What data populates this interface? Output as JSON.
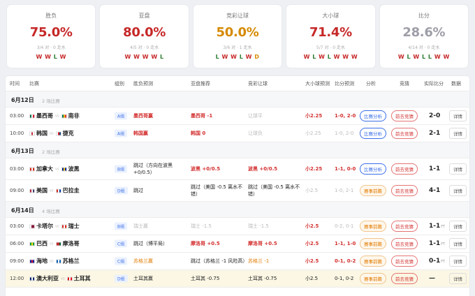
{
  "stats": [
    {
      "label": "胜负",
      "pct": "75.0%",
      "color": "#c62828",
      "sub": "3/4 对 · 0 走水",
      "seq": [
        [
          "W",
          "W"
        ],
        [
          "W",
          "W"
        ],
        [
          "L",
          "L"
        ],
        [
          "W",
          "W"
        ]
      ]
    },
    {
      "label": "亚盘",
      "pct": "80.0%",
      "color": "#c62828",
      "sub": "4/5 对 · 0 走水",
      "seq": [
        [
          "W",
          "W"
        ],
        [
          "W",
          "W"
        ],
        [
          "W",
          "W"
        ],
        [
          "W",
          "W"
        ],
        [
          "L",
          "L"
        ]
      ]
    },
    {
      "label": "竞彩让球",
      "pct": "50.0%",
      "color": "#d68a00",
      "sub": "3/6 对 · 1 走水",
      "seq": [
        [
          "L",
          "L"
        ],
        [
          "W",
          "W"
        ],
        [
          "W",
          "W"
        ],
        [
          "L",
          "L"
        ],
        [
          "W",
          "W"
        ],
        [
          "D",
          "D"
        ]
      ]
    },
    {
      "label": "大小球",
      "pct": "71.4%",
      "color": "#c62828",
      "sub": "5/7 对 · 0 走水",
      "seq": [
        [
          "W",
          "W"
        ],
        [
          "L",
          "L"
        ],
        [
          "W",
          "W"
        ],
        [
          "L",
          "L"
        ],
        [
          "W",
          "W"
        ],
        [
          "W",
          "W"
        ],
        [
          "W",
          "W"
        ]
      ]
    },
    {
      "label": "比分",
      "pct": "28.6%",
      "color": "#9e9ea8",
      "sub": "4/14 对 · 0 走水",
      "seq": [
        [
          "W",
          "W"
        ],
        [
          "L",
          "L"
        ],
        [
          "W",
          "W"
        ],
        [
          "L",
          "L"
        ],
        [
          "L",
          "L"
        ],
        [
          "W",
          "W"
        ],
        [
          "W",
          "W"
        ]
      ]
    }
  ],
  "headers": {
    "time": "时间",
    "match": "比赛",
    "group": "组别",
    "result_pred": "胜负预测",
    "asian": "亚盘推荐",
    "handicap": "竞彩让球",
    "ou_pred": "大小球预测",
    "score_pred": "比分预测",
    "analysis": "分析",
    "quiz": "竞猜",
    "actual": "实际比分",
    "data": "数据"
  },
  "days": [
    {
      "date": "6月12日",
      "count": "2 场比赛",
      "matches": [
        {
          "time": "03:00",
          "home": "墨西哥",
          "away": "南非",
          "f1": [
            "#006847",
            "#fff",
            "#ce1126"
          ],
          "f2": [
            "#007a4d",
            "#ffb612",
            "#de3831"
          ],
          "group": "A组",
          "pred": "墨西哥赢",
          "pred_cls": "red",
          "asian": "墨西哥 -1",
          "asian_cls": "red",
          "hcp": "让球平",
          "hcp_cls": "gray",
          "ou": "小2.25",
          "ou_cls": "red",
          "score": "1-0, 2-0",
          "score_cls": "red",
          "analysis": "比赛分析",
          "an_cls": "btn-blue",
          "quiz": "前去竞猜",
          "actual": "2-0",
          "ft": "",
          "data": "详情",
          "hl": false
        },
        {
          "time": "10:00",
          "home": "韩国",
          "away": "捷克",
          "f1": [
            "#fff",
            "#cd2e3a",
            "#fff"
          ],
          "f2": [
            "#fff",
            "#d7141a",
            "#11457e"
          ],
          "group": "A组",
          "pred": "韩国赢",
          "pred_cls": "red",
          "asian": "韩国 0",
          "asian_cls": "red",
          "hcp": "让球负",
          "hcp_cls": "gray",
          "ou": "小2.25",
          "ou_cls": "gray",
          "score": "1-0, 2-0",
          "score_cls": "gray",
          "analysis": "比赛分析",
          "an_cls": "btn-blue",
          "quiz": "前去竞猜",
          "actual": "2-1",
          "ft": "",
          "data": "详情",
          "hl": false
        }
      ]
    },
    {
      "date": "6月13日",
      "count": "2 场比赛",
      "matches": [
        {
          "time": "03:00",
          "home": "加拿大",
          "away": "波黑",
          "f1": [
            "#d52b1e",
            "#fff",
            "#d52b1e"
          ],
          "f2": [
            "#002395",
            "#fecb00",
            "#002395"
          ],
          "group": "B组",
          "pred": "跳过（方向在波黑+0/0.5）",
          "pred_cls": "",
          "asian": "波黑 +0/0.5",
          "asian_cls": "red",
          "hcp": "波黑 +0/0.5",
          "hcp_cls": "red",
          "ou": "小2.25",
          "ou_cls": "red",
          "score": "1-1, 0-0",
          "score_cls": "red",
          "analysis": "比赛分析",
          "an_cls": "btn-blue",
          "quiz": "前去竞猜",
          "actual": "1-1",
          "ft": "",
          "data": "详情",
          "hl": false
        },
        {
          "time": "09:00",
          "home": "美国",
          "away": "巴拉圭",
          "f1": [
            "#b22234",
            "#fff",
            "#3c3b6e"
          ],
          "f2": [
            "#d52b1e",
            "#fff",
            "#0038a8"
          ],
          "group": "D组",
          "pred": "跳过",
          "pred_cls": "",
          "asian": "跳过（美国 -0.5 离水不错）",
          "asian_cls": "",
          "hcp": "跳过（美国 -0.5 离水不错）",
          "hcp_cls": "",
          "ou": "小2.5",
          "ou_cls": "gray",
          "score": "1-0, 2-1",
          "score_cls": "gray",
          "analysis": "赛事前瞻",
          "an_cls": "btn-orange",
          "quiz": "前去竞猜",
          "actual": "4-1",
          "ft": "",
          "data": "详情",
          "hl": false
        }
      ]
    },
    {
      "date": "6月14日",
      "count": "4 场比赛",
      "matches": [
        {
          "time": "03:00",
          "home": "卡塔尔",
          "away": "瑞士",
          "f1": [
            "#fff",
            "#8a1538",
            "#8a1538"
          ],
          "f2": [
            "#d52b1e",
            "#fff",
            "#d52b1e"
          ],
          "group": "B组",
          "pred": "瑞士赢",
          "pred_cls": "gray",
          "asian": "瑞士 -1.5",
          "asian_cls": "gray",
          "hcp": "瑞士 -1.5",
          "hcp_cls": "gray",
          "ou": "小2.5",
          "ou_cls": "red",
          "score": "0-2, 0-1",
          "score_cls": "gray",
          "analysis": "赛事前瞻",
          "an_cls": "btn-orange",
          "quiz": "前去竞猜",
          "actual": "1-1",
          "ft": "FT",
          "data": "详情",
          "hl": false
        },
        {
          "time": "06:00",
          "home": "巴西",
          "away": "摩洛哥",
          "f1": [
            "#009c3b",
            "#ffdf00",
            "#009c3b"
          ],
          "f2": [
            "#c1272d",
            "#c1272d",
            "#006233"
          ],
          "group": "C组",
          "pred": "跳过（博平局）",
          "pred_cls": "",
          "asian": "摩洛哥 +0.5",
          "asian_cls": "red",
          "hcp": "摩洛哥 +0.5",
          "hcp_cls": "red",
          "ou": "小2.5",
          "ou_cls": "red",
          "score": "1-1, 1-0",
          "score_cls": "red",
          "analysis": "赛事前瞻",
          "an_cls": "btn-orange",
          "quiz": "前去竞猜",
          "actual": "1-1",
          "ft": "FT",
          "data": "详情",
          "hl": false
        },
        {
          "time": "09:00",
          "home": "海地",
          "away": "苏格兰",
          "f1": [
            "#00209f",
            "#d21034",
            "#00209f"
          ],
          "f2": [
            "#005eb8",
            "#fff",
            "#005eb8"
          ],
          "group": "C组",
          "pred": "苏格兰赢",
          "pred_cls": "orange",
          "asian": "跳过（苏格兰 -1 风险高）",
          "asian_cls": "",
          "hcp": "苏格兰 -1",
          "hcp_cls": "orange",
          "ou": "小2.5",
          "ou_cls": "red",
          "score": "0-1, 0-2",
          "score_cls": "red",
          "analysis": "赛事前瞻",
          "an_cls": "btn-orange",
          "quiz": "前去竞猜",
          "actual": "0-1",
          "ft": "FT",
          "data": "详情",
          "hl": false
        },
        {
          "time": "12:00",
          "home": "澳大利亚",
          "away": "土耳其",
          "f1": [
            "#012169",
            "#fff",
            "#012169"
          ],
          "f2": [
            "#e30a17",
            "#fff",
            "#e30a17"
          ],
          "group": "D组",
          "pred": "土耳其赢",
          "pred_cls": "",
          "asian": "土耳其 -0.75",
          "asian_cls": "",
          "hcp": "土耳其 -0.75",
          "hcp_cls": "",
          "ou": "小2.5",
          "ou_cls": "",
          "score": "0-1, 0-2",
          "score_cls": "",
          "analysis": "赛事前瞻",
          "an_cls": "btn-orange",
          "quiz": "前去竞猜",
          "actual": "—",
          "ft": "",
          "data": "详情",
          "hl": true
        }
      ]
    }
  ]
}
